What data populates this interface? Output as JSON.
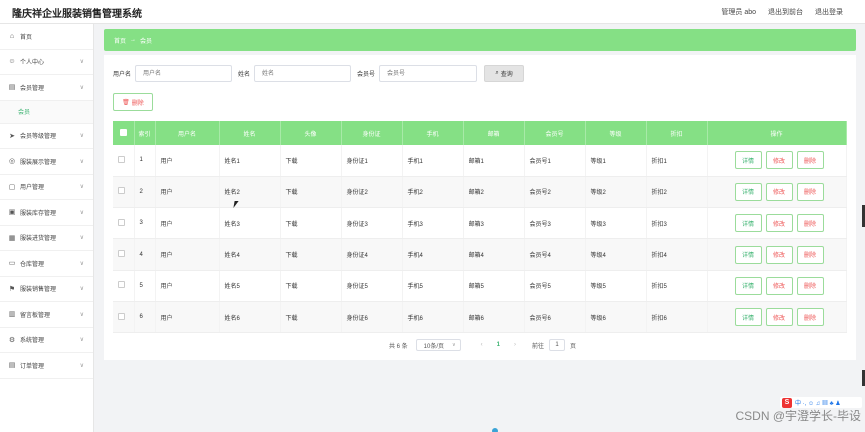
{
  "app": {
    "title": "隆庆祥企业服装销售管理系统"
  },
  "header": {
    "links": [
      "管理员 abo",
      "退出到前台",
      "退出登录"
    ]
  },
  "sidebar": {
    "items": [
      {
        "label": "首页",
        "icon": "home-icon",
        "glyph": "⌂",
        "has_chevron": false
      },
      {
        "label": "个人中心",
        "icon": "user-icon",
        "glyph": "☺",
        "has_chevron": true
      },
      {
        "label": "会员管理",
        "icon": "members-icon",
        "glyph": "▤",
        "has_chevron": true,
        "expanded": true,
        "sub": [
          "会员"
        ]
      },
      {
        "label": "会员等级管理",
        "icon": "send-icon",
        "glyph": "➤",
        "has_chevron": true
      },
      {
        "label": "服装展示管理",
        "icon": "display-icon",
        "glyph": "◎",
        "has_chevron": true
      },
      {
        "label": "用户管理",
        "icon": "folder-icon",
        "glyph": "▢",
        "has_chevron": true
      },
      {
        "label": "服装库存管理",
        "icon": "inventory-icon",
        "glyph": "▣",
        "has_chevron": true
      },
      {
        "label": "服装进货管理",
        "icon": "purchase-icon",
        "glyph": "▦",
        "has_chevron": true
      },
      {
        "label": "仓库管理",
        "icon": "warehouse-icon",
        "glyph": "▭",
        "has_chevron": true
      },
      {
        "label": "服装销售管理",
        "icon": "sales-icon",
        "glyph": "⚑",
        "has_chevron": true
      },
      {
        "label": "留言板管理",
        "icon": "message-icon",
        "glyph": "▥",
        "has_chevron": true
      },
      {
        "label": "系统管理",
        "icon": "system-icon",
        "glyph": "⚙",
        "has_chevron": true
      },
      {
        "label": "订单管理",
        "icon": "order-icon",
        "glyph": "▤",
        "has_chevron": true
      }
    ]
  },
  "breadcrumb": {
    "home": "首页",
    "current": "会员"
  },
  "search": {
    "username_label": "用户名",
    "username_placeholder": "用户名",
    "name_label": "姓名",
    "name_placeholder": "姓名",
    "member_no_label": "会员号",
    "member_no_placeholder": "会员号",
    "button": "查询"
  },
  "toolbar": {
    "delete_label": "删除"
  },
  "table": {
    "columns": [
      "索引",
      "用户名",
      "姓名",
      "头像",
      "身份证",
      "手机",
      "邮箱",
      "会员号",
      "等级",
      "折扣",
      "操作"
    ],
    "rows": [
      {
        "index": "1",
        "username": "用户",
        "name": "姓名1",
        "avatar": "下载",
        "id_card": "身份证1",
        "phone": "手机1",
        "email": "邮箱1",
        "member_no": "会员号1",
        "level": "等级1",
        "discount": "折扣1"
      },
      {
        "index": "2",
        "username": "用户",
        "name": "姓名2",
        "avatar": "下载",
        "id_card": "身份证2",
        "phone": "手机2",
        "email": "邮箱2",
        "member_no": "会员号2",
        "level": "等级2",
        "discount": "折扣2"
      },
      {
        "index": "3",
        "username": "用户",
        "name": "姓名3",
        "avatar": "下载",
        "id_card": "身份证3",
        "phone": "手机3",
        "email": "邮箱3",
        "member_no": "会员号3",
        "level": "等级3",
        "discount": "折扣3"
      },
      {
        "index": "4",
        "username": "用户",
        "name": "姓名4",
        "avatar": "下载",
        "id_card": "身份证4",
        "phone": "手机4",
        "email": "邮箱4",
        "member_no": "会员号4",
        "level": "等级4",
        "discount": "折扣4"
      },
      {
        "index": "5",
        "username": "用户",
        "name": "姓名5",
        "avatar": "下载",
        "id_card": "身份证5",
        "phone": "手机5",
        "email": "邮箱5",
        "member_no": "会员号5",
        "level": "等级5",
        "discount": "折扣5"
      },
      {
        "index": "6",
        "username": "用户",
        "name": "姓名6",
        "avatar": "下载",
        "id_card": "身份证6",
        "phone": "手机6",
        "email": "邮箱6",
        "member_no": "会员号6",
        "level": "等级6",
        "discount": "折扣6"
      }
    ],
    "actions": {
      "detail": "详情",
      "edit": "修改",
      "delete": "删除"
    }
  },
  "pagination": {
    "total_text": "共 6 条",
    "page_size": "10条/页",
    "current_page": "1",
    "goto_label": "前往",
    "goto_value": "1",
    "page_suffix": "页"
  },
  "tray": {
    "logo": "S",
    "text": "中 ·, ☺ ♫ ▦ ♣ ♟"
  },
  "watermark": "CSDN @宇澄学长-毕设",
  "colors": {
    "accent": "#85e085",
    "link_green": "#3cb371",
    "danger": "#e55555"
  }
}
